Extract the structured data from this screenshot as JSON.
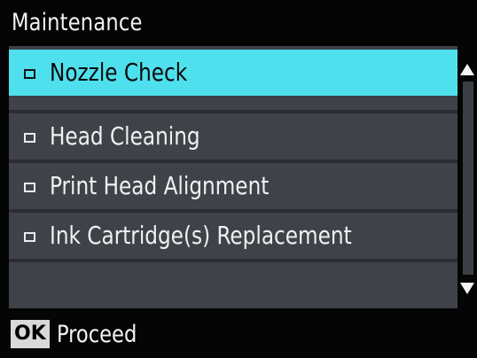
{
  "screen": {
    "title": "Maintenance"
  },
  "menu": {
    "items": [
      {
        "label": "Nozzle Check",
        "selected": true
      },
      {
        "label": "Head Cleaning",
        "selected": false
      },
      {
        "label": "Print Head Alignment",
        "selected": false
      },
      {
        "label": "Ink Cartridge(s) Replacement",
        "selected": false
      }
    ]
  },
  "footer": {
    "ok_label": "OK",
    "action_label": "Proceed"
  },
  "colors": {
    "background": "#050505",
    "list_background": "#3f4349",
    "selected_background": "#4fe0ee",
    "text": "#f0f0f0",
    "selected_text": "#0a0a0a"
  },
  "icons": {
    "bullet": "square-bullet-icon",
    "scroll_up": "scroll-up-arrow-icon",
    "scroll_down": "scroll-down-arrow-icon"
  }
}
